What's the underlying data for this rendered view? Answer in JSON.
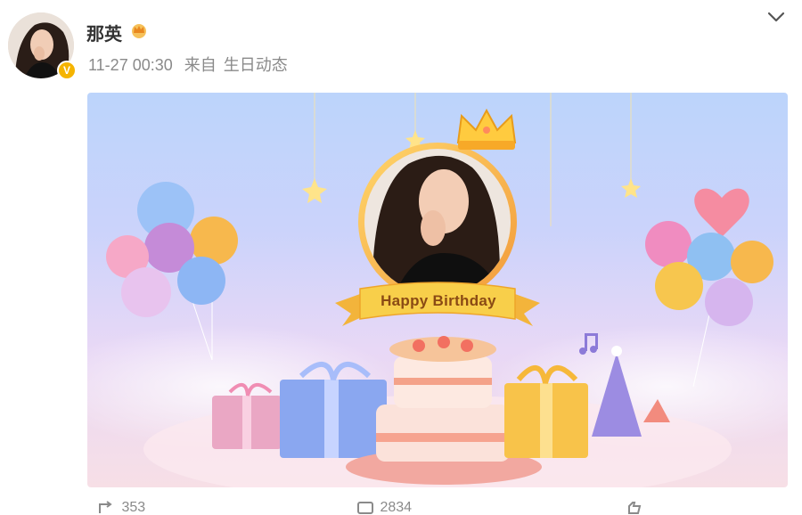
{
  "post": {
    "username": "那英",
    "time": "11-27 00:30",
    "source_prefix": "来自",
    "source": "生日动态"
  },
  "image": {
    "banner_text": "Happy Birthday"
  },
  "actions": {
    "repost_count": "353",
    "comment_count": "2834"
  },
  "colors": {
    "vip_badge": "#f5b400",
    "banner_yellow": "#f8cf4a",
    "banner_text": "#8a4a14"
  }
}
